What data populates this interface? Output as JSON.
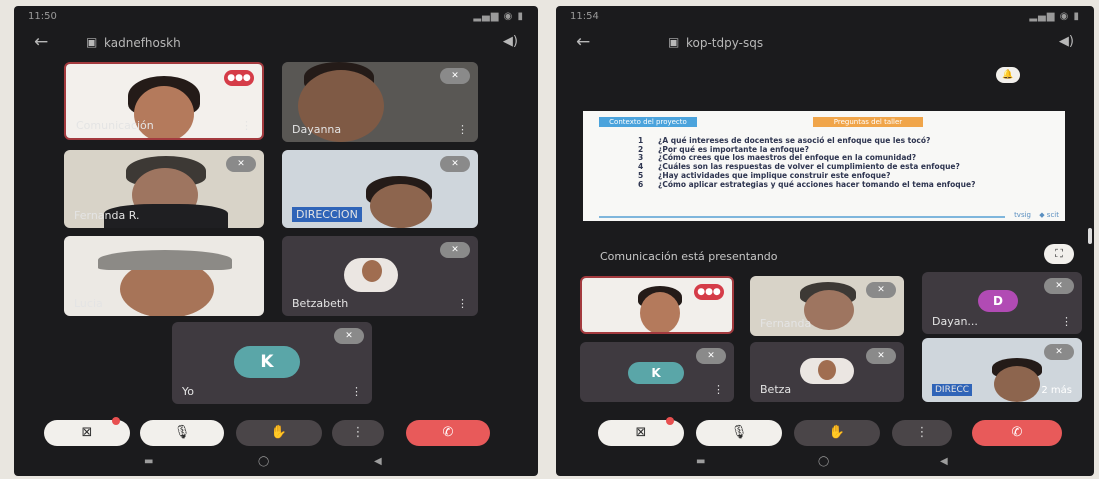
{
  "left": {
    "status_time": "11:50",
    "status_icons": "▂▄▆ ◉ ▮",
    "meeting_code": "kadnefhoskh",
    "tiles": [
      {
        "name": "Comunicación",
        "mic": "●●●"
      },
      {
        "name": "Dayanna",
        "mic": "✕"
      },
      {
        "name": "Fernanda R.",
        "mic": "✕"
      },
      {
        "name": "DIRECCION",
        "mic": "✕"
      },
      {
        "name": "Lucia",
        "mic": ""
      },
      {
        "name": "Betzabeth",
        "mic": "✕"
      },
      {
        "name": "Yo",
        "mic": "✕",
        "letter": "K"
      }
    ],
    "controls": {
      "camera": "⊠",
      "mic": "🎙",
      "hand": "✋",
      "more": "⋮",
      "end": "✆"
    }
  },
  "right": {
    "status_time": "11:54",
    "status_icons": "▂▄▆ ◉ ▮",
    "meeting_code": "kop-tdpy-sqs",
    "slide": {
      "tag1": "Contexto del proyecto",
      "tag2": "Preguntas del taller",
      "questions": [
        "¿A qué intereses de docentes se asoció el enfoque que les tocó?",
        "¿Por qué es importante la enfoque?",
        "¿Cómo crees que los maestros del enfoque en la comunidad?",
        "¿Cuáles son las respuestas de volver el cumplimiento de esta enfoque?",
        "¿Hay actividades que implique construir este enfoque?",
        "¿Cómo aplicar estrategias y qué acciones hacer tomando el tema enfoque?"
      ],
      "logo1": "tvsig",
      "logo2": "◆ scit"
    },
    "presenting_text": "Comunicación está presentando",
    "expand_icon": "⛶",
    "bell_icon": "🔔",
    "tiles": [
      {
        "name": "Comunicación",
        "mic": "●●●"
      },
      {
        "name": "Fernanda",
        "mic": "✕"
      },
      {
        "name": "Dayan...",
        "mic": "✕",
        "letter": "D"
      },
      {
        "name": "Yo",
        "mic": "✕",
        "letter": "K"
      },
      {
        "name": "Betza",
        "mic": "✕"
      },
      {
        "name": "DIRECC",
        "mic": "✕",
        "more": "2 más"
      }
    ],
    "controls": {
      "camera": "⊠",
      "mic": "🎙",
      "hand": "✋",
      "more": "⋮",
      "end": "✆"
    }
  },
  "nav": {
    "recents": "▬",
    "home": "◯",
    "back": "◀"
  },
  "back_arrow": "←",
  "cam_icon": "▣",
  "speaker_icon": "◀)",
  "kebab": "⋮",
  "colors": {
    "end_call": "#e85a5a",
    "avatar_k": "#5aa6a8",
    "avatar_d": "#b14bb4",
    "tile_bg": "#3f3a40"
  }
}
